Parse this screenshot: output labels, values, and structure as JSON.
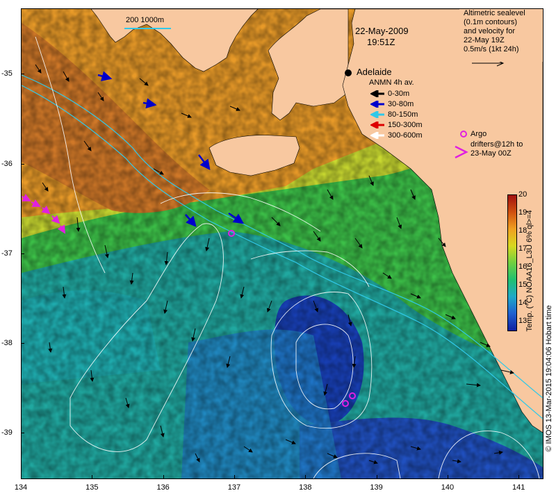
{
  "map": {
    "date": "22-May-2009",
    "time": "19:51Z",
    "place_label": "Adelaide",
    "bathymetry_label": "200  1000m",
    "altimetry_note": [
      "Altimetric sealevel",
      "(0.1m contours)",
      "and velocity for",
      "22-May 19Z",
      "0.5m/s (1kt 24h)"
    ],
    "anmn_title": "ANMN 4h av.",
    "anmn_legend": [
      {
        "label": "0-30m",
        "color": "#000000"
      },
      {
        "label": "30-80m",
        "color": "#0000cc"
      },
      {
        "label": "80-150m",
        "color": "#30c8e8"
      },
      {
        "label": "150-300m",
        "color": "#dd0000"
      },
      {
        "label": "300-600m",
        "color": "#ffffff"
      }
    ],
    "argo_label": "Argo",
    "drifters_label": [
      "drifters@12h to",
      "23-May 00Z"
    ],
    "argo_color": "#e020e0",
    "land_color": "#f8c8a0",
    "x_ticks": [
      "134",
      "135",
      "136",
      "137",
      "138",
      "139",
      "140",
      "141"
    ],
    "y_ticks": [
      "-35",
      "-36",
      "-37",
      "-38",
      "-39"
    ]
  },
  "colorbar": {
    "title": "Temp. (°C) NOAA16_L3U 6% ql>=4",
    "ticks": [
      "20",
      "19",
      "18",
      "17",
      "16",
      "15",
      "14",
      "13"
    ],
    "min": 12.5,
    "max": 20,
    "colors": [
      "#1020a0",
      "#2060d0",
      "#20a8c8",
      "#20c070",
      "#70d040",
      "#d8d820",
      "#f0a020",
      "#d05010",
      "#a01010"
    ]
  },
  "credit": "© IMOS 13-Mar-2015 19:04:06 Hobart time"
}
